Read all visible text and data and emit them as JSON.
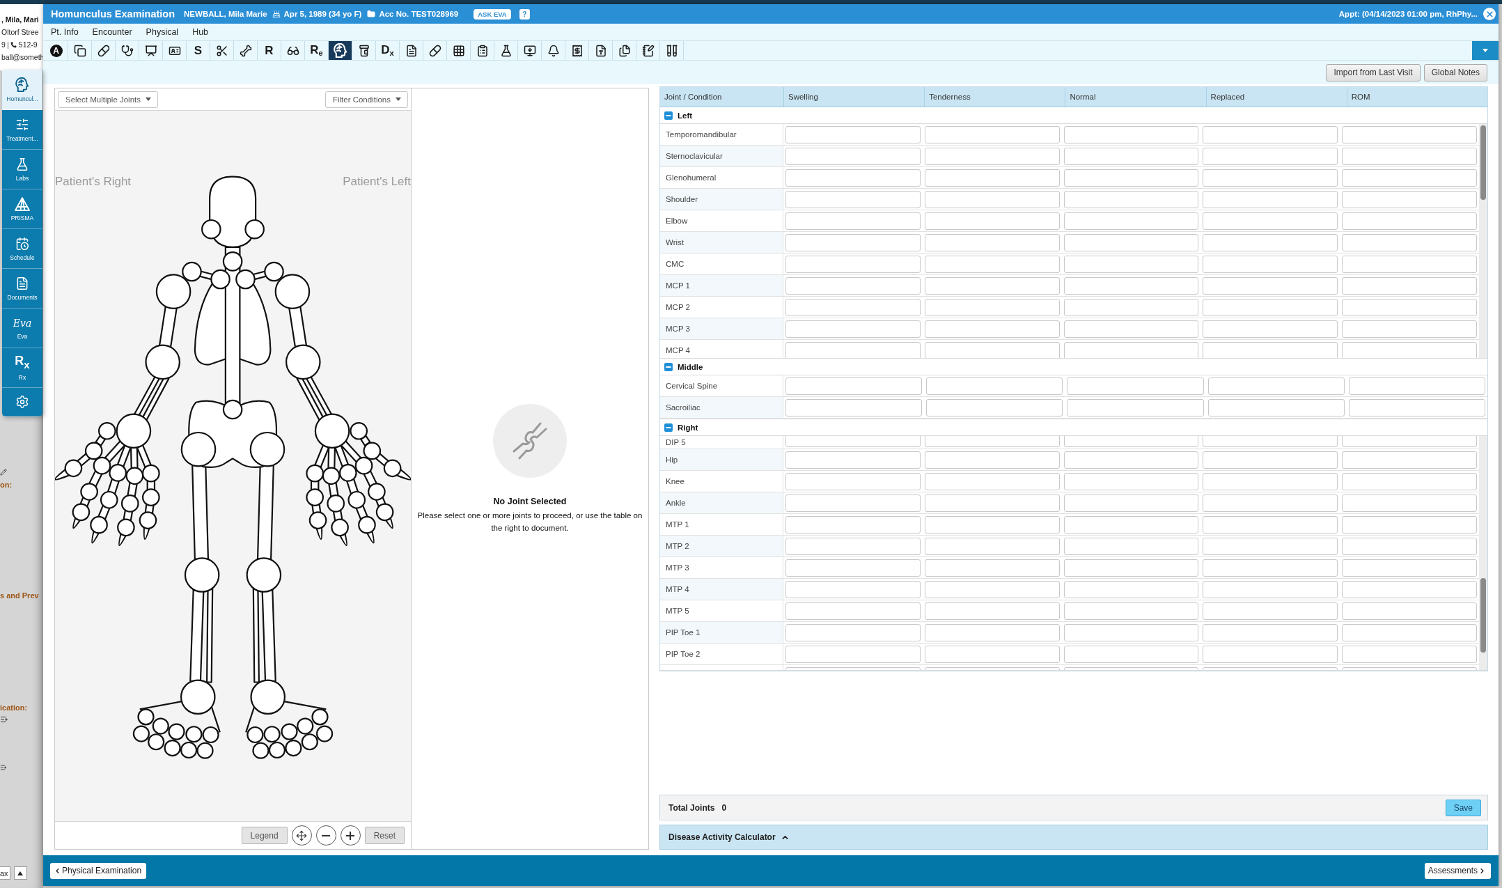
{
  "background_app": {
    "patient_name": ", Mila, Mari",
    "street": "Oltorf Stree",
    "phone_prefix": "9",
    "phone": "512-9",
    "email": "ball@someth",
    "headings": [
      "on:",
      "s and Prev",
      "ication:"
    ],
    "bottom_field": "ax"
  },
  "sidebar": {
    "items": [
      {
        "label": "Homuncul...",
        "selected": true
      },
      {
        "label": "Treatment...",
        "selected": false
      },
      {
        "label": "Labs",
        "selected": false
      },
      {
        "label": "PRISMA",
        "selected": false
      },
      {
        "label": "Schedule",
        "selected": false
      },
      {
        "label": "Documents",
        "selected": false
      },
      {
        "label": "Eva",
        "glyph": "Eva",
        "selected": false
      },
      {
        "label": "Rx",
        "glyph": "R$_{x}$",
        "selected": false
      },
      {
        "selected": false
      }
    ]
  },
  "window": {
    "title": "Homunculus Examination",
    "patient": "NEWBALL, Mila Marie",
    "dob": "Apr 5, 1989 (34 yo F)",
    "account": "Acc No. TEST028969",
    "ask_button": "ASK EVA",
    "help_button": "?",
    "appointment": "Appt: (04/14/2023 01:00 pm, RhPhy..."
  },
  "menu": [
    "Pt. Info",
    "Encounter",
    "Physical",
    "Hub"
  ],
  "toolbar": [
    {
      "kind": "circle_letter",
      "label": "A",
      "selected": false
    },
    {
      "kind": "icon",
      "selected": false
    },
    {
      "kind": "icon",
      "selected": false
    },
    {
      "kind": "icon",
      "selected": false
    },
    {
      "kind": "icon",
      "selected": false
    },
    {
      "kind": "icon",
      "selected": false
    },
    {
      "kind": "letter",
      "label": "S",
      "selected": false
    },
    {
      "kind": "icon",
      "selected": false
    },
    {
      "kind": "icon",
      "selected": false
    },
    {
      "kind": "letter",
      "label": "R",
      "selected": false
    },
    {
      "kind": "icon",
      "selected": false
    },
    {
      "kind": "letter",
      "label": "R$_{e}$",
      "selected": false
    },
    {
      "kind": "icon",
      "selected": true
    },
    {
      "kind": "icon",
      "selected": false
    },
    {
      "kind": "letter",
      "label": "D$_{x}$",
      "selected": false
    },
    {
      "kind": "icon",
      "selected": false
    },
    {
      "kind": "icon",
      "selected": false
    },
    {
      "kind": "icon",
      "selected": false
    },
    {
      "kind": "icon",
      "selected": false
    },
    {
      "kind": "icon",
      "selected": false
    },
    {
      "kind": "icon",
      "selected": false
    },
    {
      "kind": "icon",
      "selected": false
    },
    {
      "kind": "icon",
      "selected": false
    },
    {
      "kind": "icon",
      "selected": false
    },
    {
      "kind": "icon",
      "selected": false
    },
    {
      "kind": "icon",
      "selected": false
    },
    {
      "kind": "icon",
      "selected": false
    }
  ],
  "actions": [
    "Import from Last Visit",
    "Global Notes"
  ],
  "diagram": {
    "select_button": "Select Multiple Joints",
    "filter_button": "Filter Conditions",
    "right_label": "Patient's Right",
    "left_label": "Patient's Left",
    "legend_button": "Legend",
    "reset_button": "Reset"
  },
  "info": {
    "title": "No Joint Selected",
    "message": "Please select one or more joints to proceed, or use the table on the right to document."
  },
  "table": {
    "columns": [
      "Joint / Condition",
      "Swelling",
      "Tenderness",
      "Normal",
      "Replaced",
      "ROM"
    ],
    "groups": [
      {
        "label": "Left",
        "expanded": true,
        "scrollable": true,
        "rows": [
          {
            "kind": "row",
            "label": "Temporomandibular"
          },
          {
            "kind": "row",
            "label": "Sternoclavicular"
          },
          {
            "kind": "row",
            "label": "Glenohumeral"
          },
          {
            "kind": "row",
            "label": "Shoulder"
          },
          {
            "kind": "row",
            "label": "Elbow"
          },
          {
            "kind": "row",
            "label": "Wrist"
          },
          {
            "kind": "row",
            "label": "CMC"
          },
          {
            "kind": "row",
            "label": "MCP 1"
          },
          {
            "kind": "row",
            "label": "MCP 2"
          },
          {
            "kind": "row",
            "label": "MCP 3"
          },
          {
            "kind": "row",
            "label": "MCP 4"
          }
        ]
      },
      {
        "label": "Middle",
        "expanded": true,
        "scrollable": false,
        "rows": [
          {
            "kind": "row",
            "label": "Cervical Spine"
          },
          {
            "kind": "row",
            "label": "Sacroiliac"
          }
        ]
      },
      {
        "label": "Right",
        "expanded": true,
        "scrollable": true,
        "rows": [
          {
            "kind": "clipped_top",
            "label": "DIP 5"
          },
          {
            "kind": "row",
            "label": "Hip"
          },
          {
            "kind": "row",
            "label": "Knee"
          },
          {
            "kind": "row",
            "label": "Ankle"
          },
          {
            "kind": "row",
            "label": "MTP 1"
          },
          {
            "kind": "row",
            "label": "MTP 2"
          },
          {
            "kind": "row",
            "label": "MTP 3"
          },
          {
            "kind": "row",
            "label": "MTP 4"
          },
          {
            "kind": "row",
            "label": "MTP 5"
          },
          {
            "kind": "row",
            "label": "PIP Toe 1"
          },
          {
            "kind": "row",
            "label": "PIP Toe 2"
          },
          {
            "kind": "clipped_bottom"
          }
        ]
      }
    ]
  },
  "totals": {
    "label": "Total Joints",
    "value": "0",
    "save_button": "Save"
  },
  "calculator": {
    "label": "Disease Activity Calculator"
  },
  "footer": {
    "back_button": "Physical Examination",
    "next_button": "Assessments"
  }
}
